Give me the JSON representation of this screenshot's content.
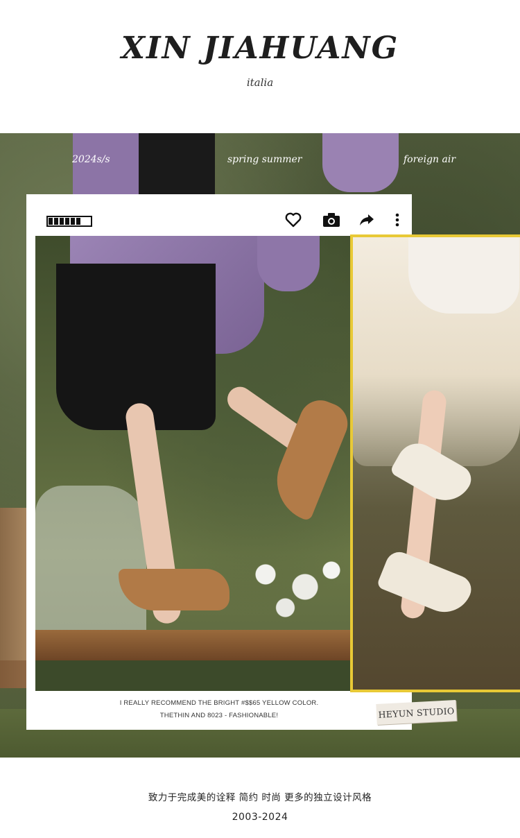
{
  "brand": {
    "title": "XIN JIAHUANG",
    "subtitle": "italia"
  },
  "band_tags": {
    "season": "2024s/s",
    "theme": "spring summer",
    "style": "foreign air"
  },
  "toolbar": {
    "icons": [
      "battery-icon",
      "heart-icon",
      "camera-icon",
      "share-icon",
      "more-vertical-icon"
    ]
  },
  "caption": {
    "line1": "I REALLY RECOMMEND THE BRIGHT #$$65   YELLOW COLOR.",
    "line2": "THETHIN AND 8023 - FASHIONABLE!"
  },
  "studio_label": "HEYUN STUDIO",
  "footer": {
    "slogan": "致力于完成美的诠释 简约 时尚 更多的独立设计风格",
    "years": "2003-2024"
  },
  "colors": {
    "inset_border": "#e8c936",
    "jacket": "#8c74a6",
    "shoe_brown": "#b27b48",
    "shoe_cream": "#f1ebdf"
  }
}
